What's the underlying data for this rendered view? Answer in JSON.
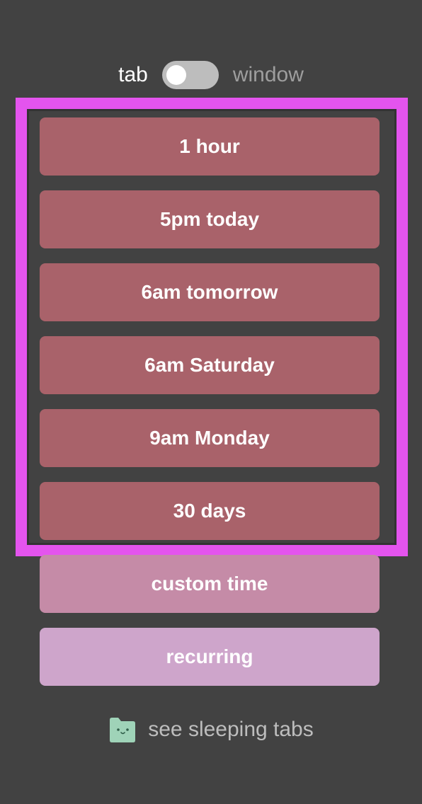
{
  "toggle": {
    "left_label": "tab",
    "right_label": "window",
    "state": "tab"
  },
  "options": [
    {
      "label": "1 hour"
    },
    {
      "label": "5pm today"
    },
    {
      "label": "6am tomorrow"
    },
    {
      "label": "6am Saturday"
    },
    {
      "label": "9am Monday"
    },
    {
      "label": "30 days"
    }
  ],
  "custom_label": "custom time",
  "recurring_label": "recurring",
  "footer": {
    "label": "see sleeping tabs",
    "icon": "folder-face-icon"
  },
  "colors": {
    "background": "#424242",
    "preset_button": "#a9626a",
    "custom_button": "#c58ba7",
    "recurring_button": "#cea5cb",
    "highlight": "#e454ee",
    "icon": "#9fd3b8"
  }
}
